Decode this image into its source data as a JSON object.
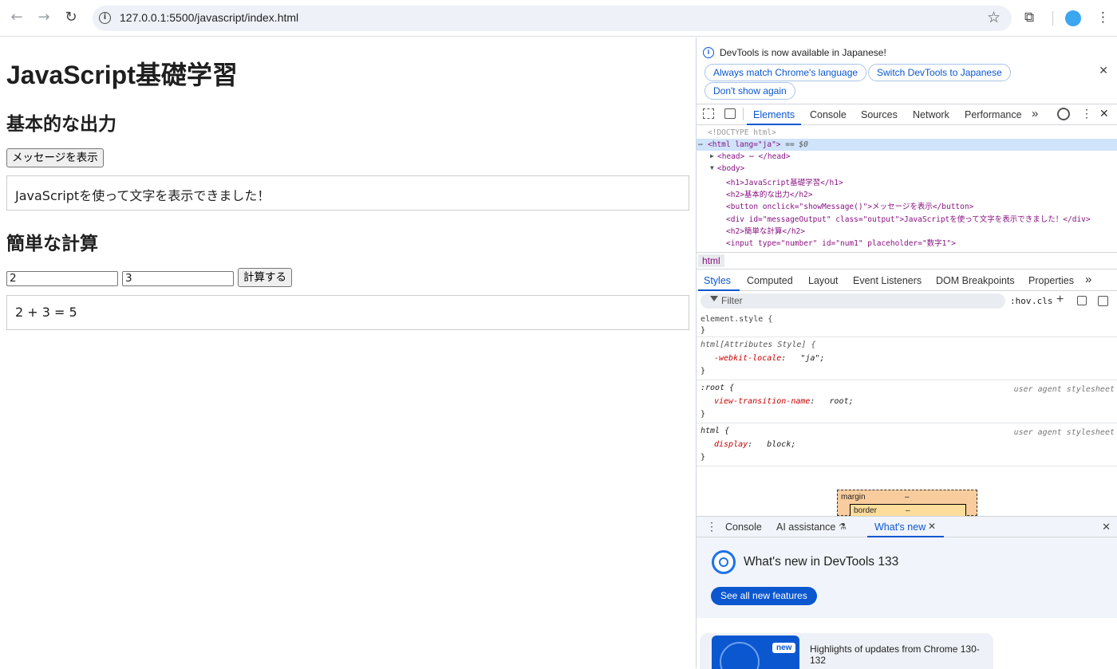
{
  "browser": {
    "url": "127.0.0.1:5500/javascript/index.html",
    "back_icon": "←",
    "forward_icon": "→",
    "reload_icon": "↻",
    "star_icon": "☆",
    "extensions_icon": "⧉",
    "menu_icon": "⋮",
    "info_icon": "i"
  },
  "page": {
    "title": "JavaScript基礎学習",
    "section1_heading": "基本的な出力",
    "show_message_button": "メッセージを表示",
    "message_output": "JavaScriptを使って文字を表示できました！",
    "section2_heading": "簡単な計算",
    "num1_value": "2",
    "num2_value": "3",
    "calc_button": "計算する",
    "calc_output": "2 + 3 = 5"
  },
  "devtools": {
    "infobar": {
      "message": "DevTools is now available in Japanese!",
      "btn_match": "Always match Chrome's language",
      "btn_switch": "Switch DevTools to Japanese",
      "btn_dont_show": "Don't show again",
      "close": "✕"
    },
    "tabs": [
      "Elements",
      "Console",
      "Sources",
      "Network",
      "Performance"
    ],
    "more_tabs": "»",
    "close": "✕",
    "elements": {
      "doctype": "<!DOCTYPE html>",
      "html_open": "<html lang=\"ja\">",
      "html_suffix": " == $0",
      "head": "<head> ⋯ </head>",
      "body": "<body>",
      "h1": "<h1>JavaScript基礎学習</h1>",
      "h2a": "<h2>基本的な出力</h2>",
      "button": "<button onclick=\"showMessage()\">メッセージを表示</button>",
      "div": "<div id=\"messageOutput\" class=\"output\">JavaScriptを使って文字を表示できました！</div>",
      "h2b": "<h2>簡単な計算</h2>",
      "input": "<input type=\"number\" id=\"num1\" placeholder=\"数字1\">"
    },
    "breadcrumb": "html",
    "style_tabs": [
      "Styles",
      "Computed",
      "Layout",
      "Event Listeners",
      "DOM Breakpoints",
      "Properties"
    ],
    "filter_placeholder": "Filter",
    "hov": ":hov",
    "cls": ".cls",
    "rules": {
      "r1_sel": "element.style {",
      "r2_sel": "html[Attributes Style] {",
      "r2_prop": "-webkit-locale",
      "r2_val": "\"ja\";",
      "r3_sel": ":root {",
      "r3_prop": "view-transition-name",
      "r3_val": "root;",
      "r4_sel": "html {",
      "r4_prop": "display",
      "r4_val": "block;",
      "close_brace": "}",
      "ua": "user agent stylesheet"
    },
    "boxmodel": {
      "margin": "margin",
      "border": "border",
      "dash": "–"
    },
    "drawer": {
      "tabs": [
        "Console",
        "AI assistance",
        "What's new"
      ],
      "whats_new_title": "What's new in DevTools 133",
      "see_all": "See all new features",
      "new_badge": "new",
      "highlights": "Highlights of updates from Chrome 130-132"
    }
  }
}
